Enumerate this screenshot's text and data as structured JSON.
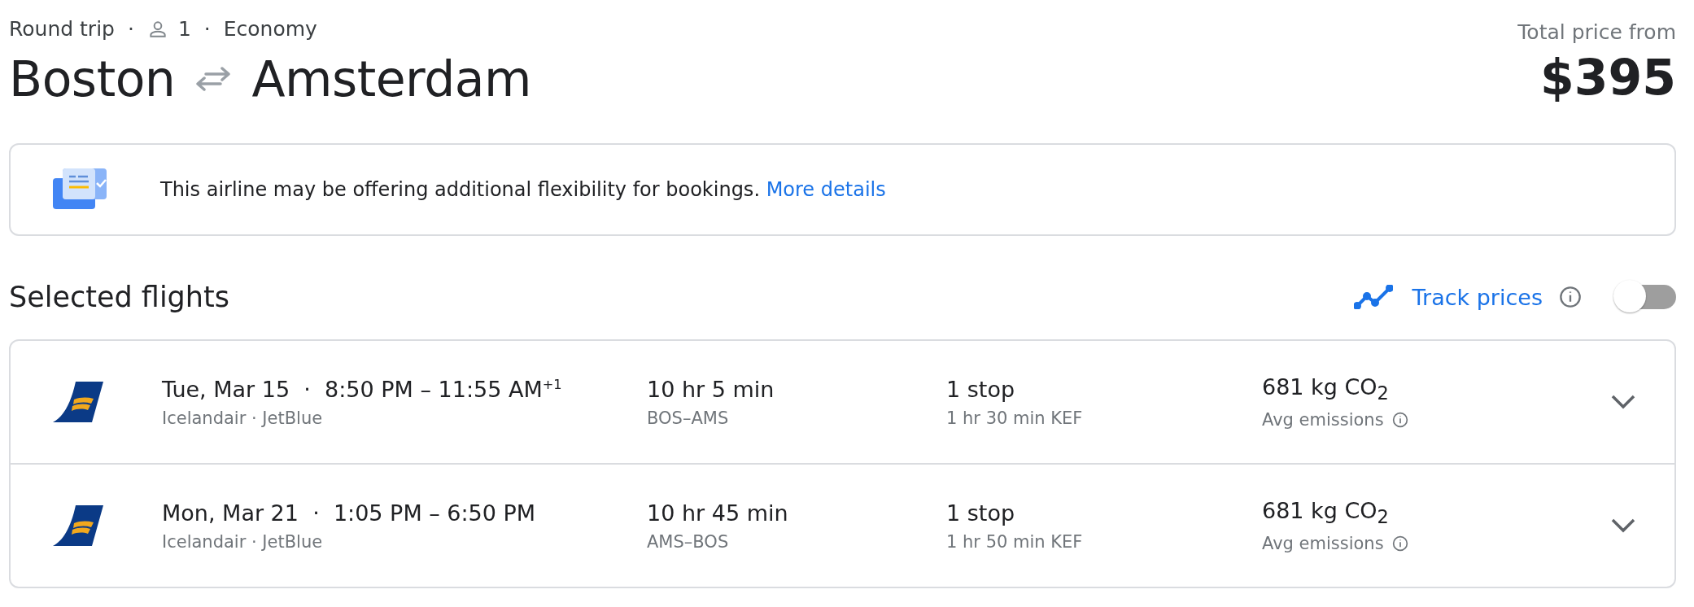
{
  "trip": {
    "type": "Round trip",
    "passengers": "1",
    "cabin": "Economy",
    "separator": "·"
  },
  "route": {
    "origin": "Boston",
    "destination": "Amsterdam"
  },
  "price": {
    "label": "Total price from",
    "amount": "$395"
  },
  "notice": {
    "text": "This airline may be offering additional flexibility for bookings.",
    "link": "More details"
  },
  "selected": {
    "title": "Selected flights",
    "track_label": "Track prices",
    "track_on": false
  },
  "flights": [
    {
      "times": "Tue, Mar 15  ·  8:50 PM – 11:55 AM$^{+1}$",
      "airlines": "Icelandair · JetBlue",
      "duration": "10 hr 5 min",
      "route": "BOS–AMS",
      "stops": "1 stop",
      "layover": "1 hr 30 min KEF",
      "emissions": "681 kg CO$_{2}$",
      "emissions_label": "Avg emissions",
      "expanded": false
    },
    {
      "times": "Mon, Mar 21  ·  1:05 PM – 6:50 PM",
      "airlines": "Icelandair · JetBlue",
      "duration": "10 hr 45 min",
      "route": "AMS–BOS",
      "stops": "1 stop",
      "layover": "1 hr 50 min KEF",
      "emissions": "681 kg CO$_{2}$",
      "emissions_label": "Avg emissions",
      "expanded": false
    }
  ]
}
